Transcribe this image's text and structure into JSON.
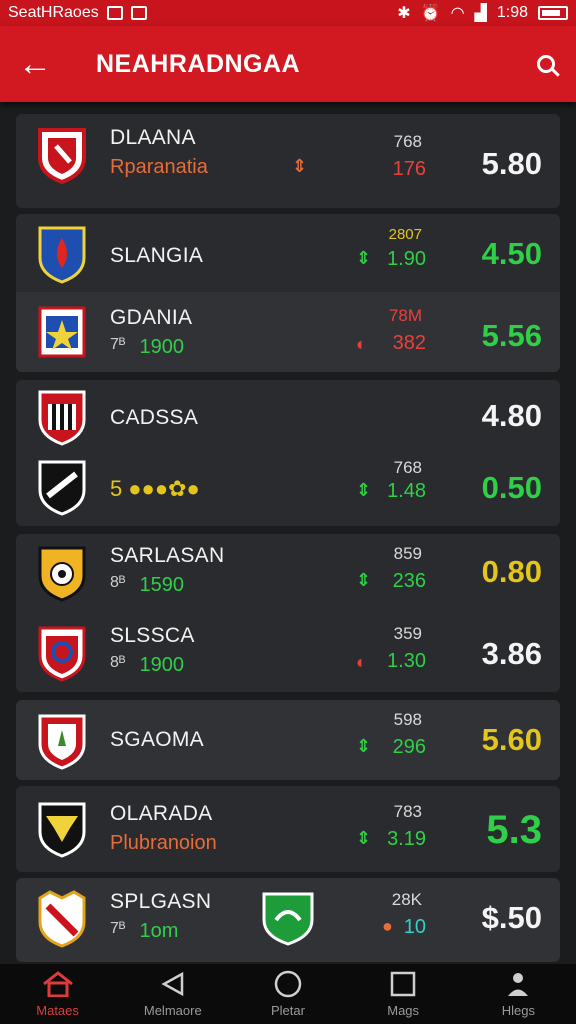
{
  "status_bar": {
    "app": "SeatHRaoes",
    "time": "1:98"
  },
  "app_bar": {
    "title": "NEAHRADNGAA"
  },
  "rows": [
    {
      "name": "DLAANA",
      "sub_pre": "",
      "sub": "Rparanatia",
      "odd_top": "768",
      "odd_bot": "176",
      "trend": "up",
      "price": "5.80"
    },
    {
      "name": "SLANGIA",
      "sub_pre": "",
      "sub": "",
      "odd_top": "2807",
      "odd_bot": "1.90",
      "trend": "up",
      "price": "4.50"
    },
    {
      "name": "GDANIA",
      "sub_pre": "7ᴮ",
      "sub": "1900",
      "odd_top": "78M",
      "odd_bot": "382",
      "trend": "down",
      "price": "5.56"
    },
    {
      "name": "CADSSA",
      "sub_pre": "",
      "sub": "",
      "odd_top": "",
      "odd_bot": "",
      "trend": "",
      "price": "4.80"
    },
    {
      "name": "",
      "sub_pre": "",
      "sub": "5",
      "odd_top": "768",
      "odd_bot": "1.48",
      "trend": "up",
      "price": "0.50"
    },
    {
      "name": "SARLASAN",
      "sub_pre": "8ᴮ",
      "sub": "1590",
      "odd_top": "859",
      "odd_bot": "236",
      "trend": "up",
      "price": "0.80"
    },
    {
      "name": "SLSSCA",
      "sub_pre": "8ᴮ",
      "sub": "1900",
      "odd_top": "359",
      "odd_bot": "1.30",
      "trend": "down",
      "price": "3.86"
    },
    {
      "name": "SGAOMA",
      "sub_pre": "",
      "sub": "",
      "odd_top": "598",
      "odd_bot": "296",
      "trend": "up",
      "price": "5.60"
    },
    {
      "name": "OLARADA",
      "sub_pre": "",
      "sub": "Plubranoion",
      "odd_top": "783",
      "odd_bot": "3.19",
      "trend": "up",
      "price": "5.3"
    },
    {
      "name": "SPLGASN",
      "sub_pre": "7ᴮ",
      "sub": "1om",
      "odd_top": "28K",
      "odd_bot": "10",
      "trend": "neutral",
      "price": "$.50"
    }
  ],
  "nav": [
    {
      "label": "Mataes",
      "icon": "home-icon",
      "active": true
    },
    {
      "label": "Melmaore",
      "icon": "back-triangle-icon",
      "active": false
    },
    {
      "label": "Pletar",
      "icon": "circle-icon",
      "active": false
    },
    {
      "label": "Mags",
      "icon": "square-icon",
      "active": false
    },
    {
      "label": "Hlegs",
      "icon": "person-icon",
      "active": false
    }
  ],
  "colors": {
    "brand_red": "#d21820",
    "up_green": "#2fd048",
    "down_red": "#e8413b",
    "yellow": "#e3c51c",
    "orange_text": "#e86b3a"
  }
}
